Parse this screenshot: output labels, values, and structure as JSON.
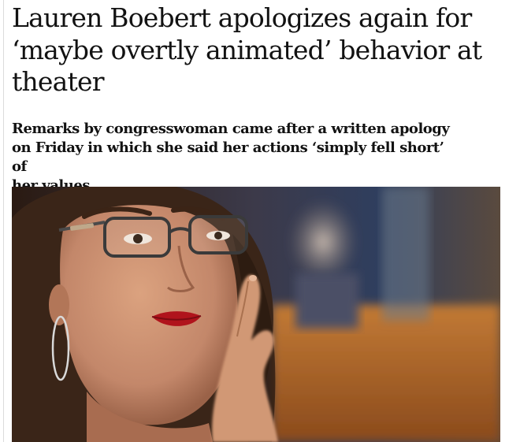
{
  "article": {
    "headline_lines": [
      "Lauren Boebert apologizes again for",
      "‘maybe overtly animated’ behavior at",
      "theater"
    ],
    "standfirst_lines": [
      "Remarks by congresswoman came after a written apology",
      "on Friday in which she said her actions ‘simply fell short’ of",
      "her values"
    ]
  },
  "photo": {
    "subject": "woman-with-glasses-hand-on-cheek",
    "colors": {
      "hair": "#3a2518",
      "skin": "#c98e6c",
      "lips": "#b0141c",
      "background_warm": "#b86a2a",
      "background_cool": "#2f3e5e"
    }
  }
}
